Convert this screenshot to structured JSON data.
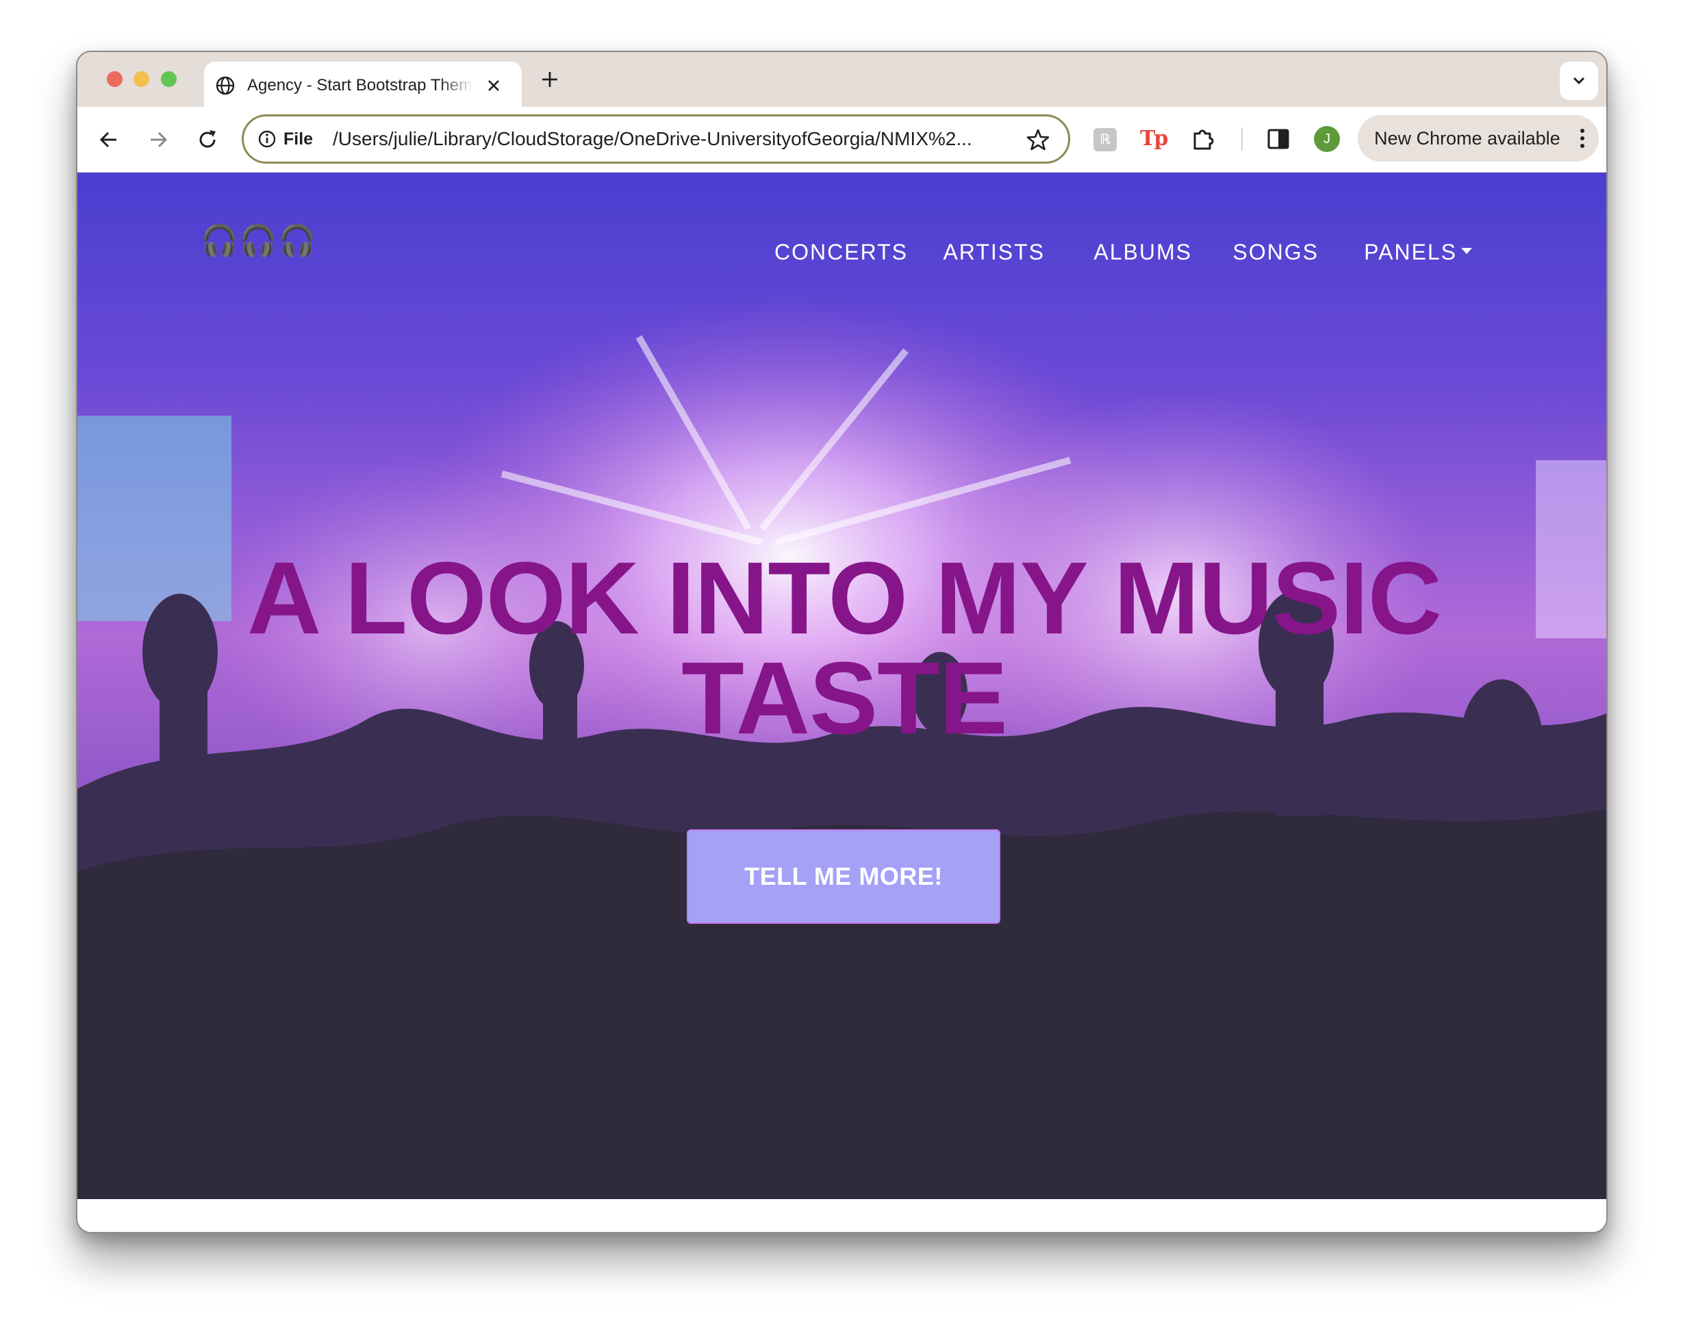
{
  "browser": {
    "tab_title": "Agency - Start Bootstrap Theme",
    "address_scheme": "File",
    "address_url": "/Users/julie/Library/CloudStorage/OneDrive-UniversityofGeorgia/NMIX%2...",
    "profile_initial": "J",
    "update_chip_label": "New Chrome available",
    "extensions": [
      "reader-extension-icon",
      "tp-extension-icon",
      "puzzle-icon",
      "side-panel-icon"
    ]
  },
  "site": {
    "brand": "🎧🎧🎧",
    "nav": [
      {
        "label": "CONCERTS"
      },
      {
        "label": "ARTISTS"
      },
      {
        "label": "ALBUMS"
      },
      {
        "label": "SONGS"
      },
      {
        "label": "PANELS"
      }
    ],
    "hero": {
      "title_line1": "A LOOK INTO MY MUSIC",
      "title_line2": "TASTE",
      "cta_label": "TELL ME MORE!"
    }
  },
  "colors": {
    "hero_title": "#86158a",
    "cta_background": "#a4a1f6",
    "cta_border": "#c678e6",
    "address_border": "#8d8a53"
  }
}
